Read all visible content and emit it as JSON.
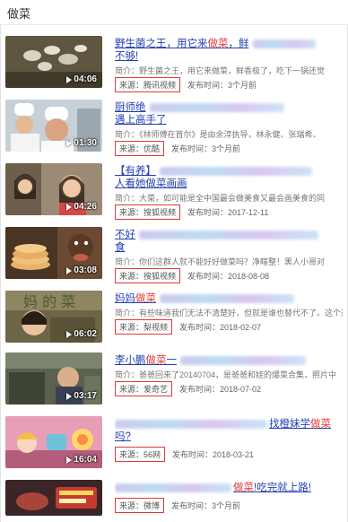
{
  "search": {
    "value": "做菜"
  },
  "results": [
    {
      "title_pre": "野生菌之王，用它来",
      "title_hl": "做菜",
      "title_post": "，鲜",
      "title_line2": "不够!",
      "summary": "简介：野生菌之王，用它来做菜，鲜香极了，吃下一锅还觉",
      "source": "来源：腾讯视频",
      "date": "发布时间：3个月前",
      "duration": "04:06"
    },
    {
      "title_pre": "厨师绝",
      "title_hl": "",
      "title_post": "",
      "title_line2": "遇上高手了",
      "summary": "简介：《林师傅在首尔》是由余淳执导，林永健、张瑞希、",
      "source": "来源：优酷",
      "date": "发布时间：3个月前",
      "duration": "01:30"
    },
    {
      "title_pre": "【有养】",
      "title_hl": "",
      "title_post": "",
      "title_line2": "人看她做菜画画",
      "summary": "简介：大菜，如可能是全中国最会做美食又最会画美食的同",
      "source": "来源：搜狐视频",
      "date": "发布时间：2017-12-11",
      "duration": "04:26"
    },
    {
      "title_pre": "不好",
      "title_hl": "",
      "title_post": "",
      "title_line2": "食",
      "summary": "简介：你们这群人就不能好好做菜吗？净瞎整！黑人小哥对",
      "source": "来源：搜狐视频",
      "date": "发布时间：2018-08-08",
      "duration": "03:08"
    },
    {
      "title_pre": "妈妈",
      "title_hl": "做菜",
      "title_post": "",
      "title_line2": "",
      "summary": "简介：有些味道我们无法不清楚好，但就是谁也替代不了。这个过",
      "source": "来源：梨视频",
      "date": "发布时间：2018-02-07",
      "duration": "06:02"
    },
    {
      "title_pre": "李小鹏",
      "title_hl": "做菜",
      "title_post": "一",
      "title_line2": "",
      "summary": "简介：爸爸回来了20140704，是爸爸和娃的爆菜合集，照片中",
      "source": "来源：爱奇艺",
      "date": "发布时间：2018-07-02",
      "duration": "03:17"
    },
    {
      "title_pre": "",
      "title_hl": "",
      "title_post": "找橙妹学",
      "title_post_hl": "做菜",
      "title_line2": "吗?",
      "summary": "",
      "source": "来源：56网",
      "date": "发布时间：2018-03-21",
      "duration": "16:04"
    },
    {
      "title_pre": "",
      "title_hl": "",
      "title_post": "做菜",
      "title_post2": "!吃完就上路!",
      "title_line2": "",
      "summary": "",
      "source": "来源：微博",
      "date": "发布时间：3个月前",
      "duration": ""
    }
  ],
  "thumb_colors": [
    "#6b6148",
    "#b7c3cc",
    "#8a7a66",
    "#5d3f2b",
    "#7a6a4e",
    "#4e5548",
    "#8e5b73",
    "#3b2a2a"
  ]
}
